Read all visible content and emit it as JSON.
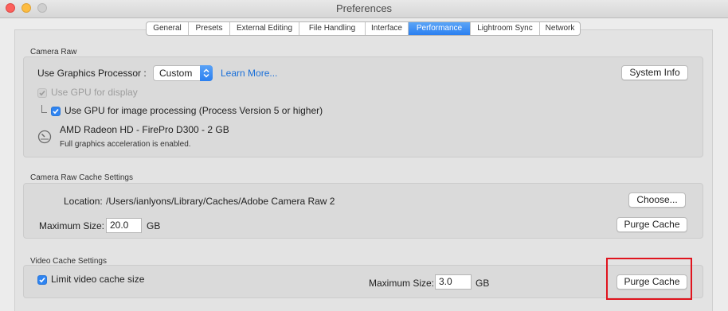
{
  "window": {
    "title": "Preferences"
  },
  "tabs": [
    {
      "label": "General"
    },
    {
      "label": "Presets"
    },
    {
      "label": "External Editing"
    },
    {
      "label": "File Handling"
    },
    {
      "label": "Interface"
    },
    {
      "label": "Performance",
      "active": true
    },
    {
      "label": "Lightroom Sync"
    },
    {
      "label": "Network"
    }
  ],
  "camera_raw": {
    "title": "Camera Raw",
    "gpu_label": "Use Graphics Processor :",
    "gpu_value": "Custom",
    "learn_more": "Learn More...",
    "system_info": "System Info",
    "gpu_display": {
      "label": "Use GPU for display",
      "checked": true,
      "enabled": false
    },
    "gpu_processing": {
      "label": "Use GPU for image processing (Process Version 5 or higher)",
      "checked": true
    },
    "gpu_name": "AMD Radeon HD - FirePro D300 - 2 GB",
    "gpu_status": "Full graphics acceleration is enabled."
  },
  "cache": {
    "title": "Camera Raw Cache Settings",
    "location_label": "Location:",
    "location_path": "/Users/ianlyons/Library/Caches/Adobe Camera Raw 2",
    "choose": "Choose...",
    "max_label": "Maximum Size:",
    "max_value": "20.0",
    "unit": "GB",
    "purge": "Purge Cache"
  },
  "video": {
    "title": "Video Cache Settings",
    "limit_label": "Limit video cache size",
    "limit_checked": true,
    "max_label": "Maximum Size:",
    "max_value": "3.0",
    "unit": "GB",
    "purge": "Purge Cache"
  },
  "colors": {
    "accent": "#2f84f1",
    "link": "#1a6fd8",
    "highlight": "#e0141e"
  }
}
